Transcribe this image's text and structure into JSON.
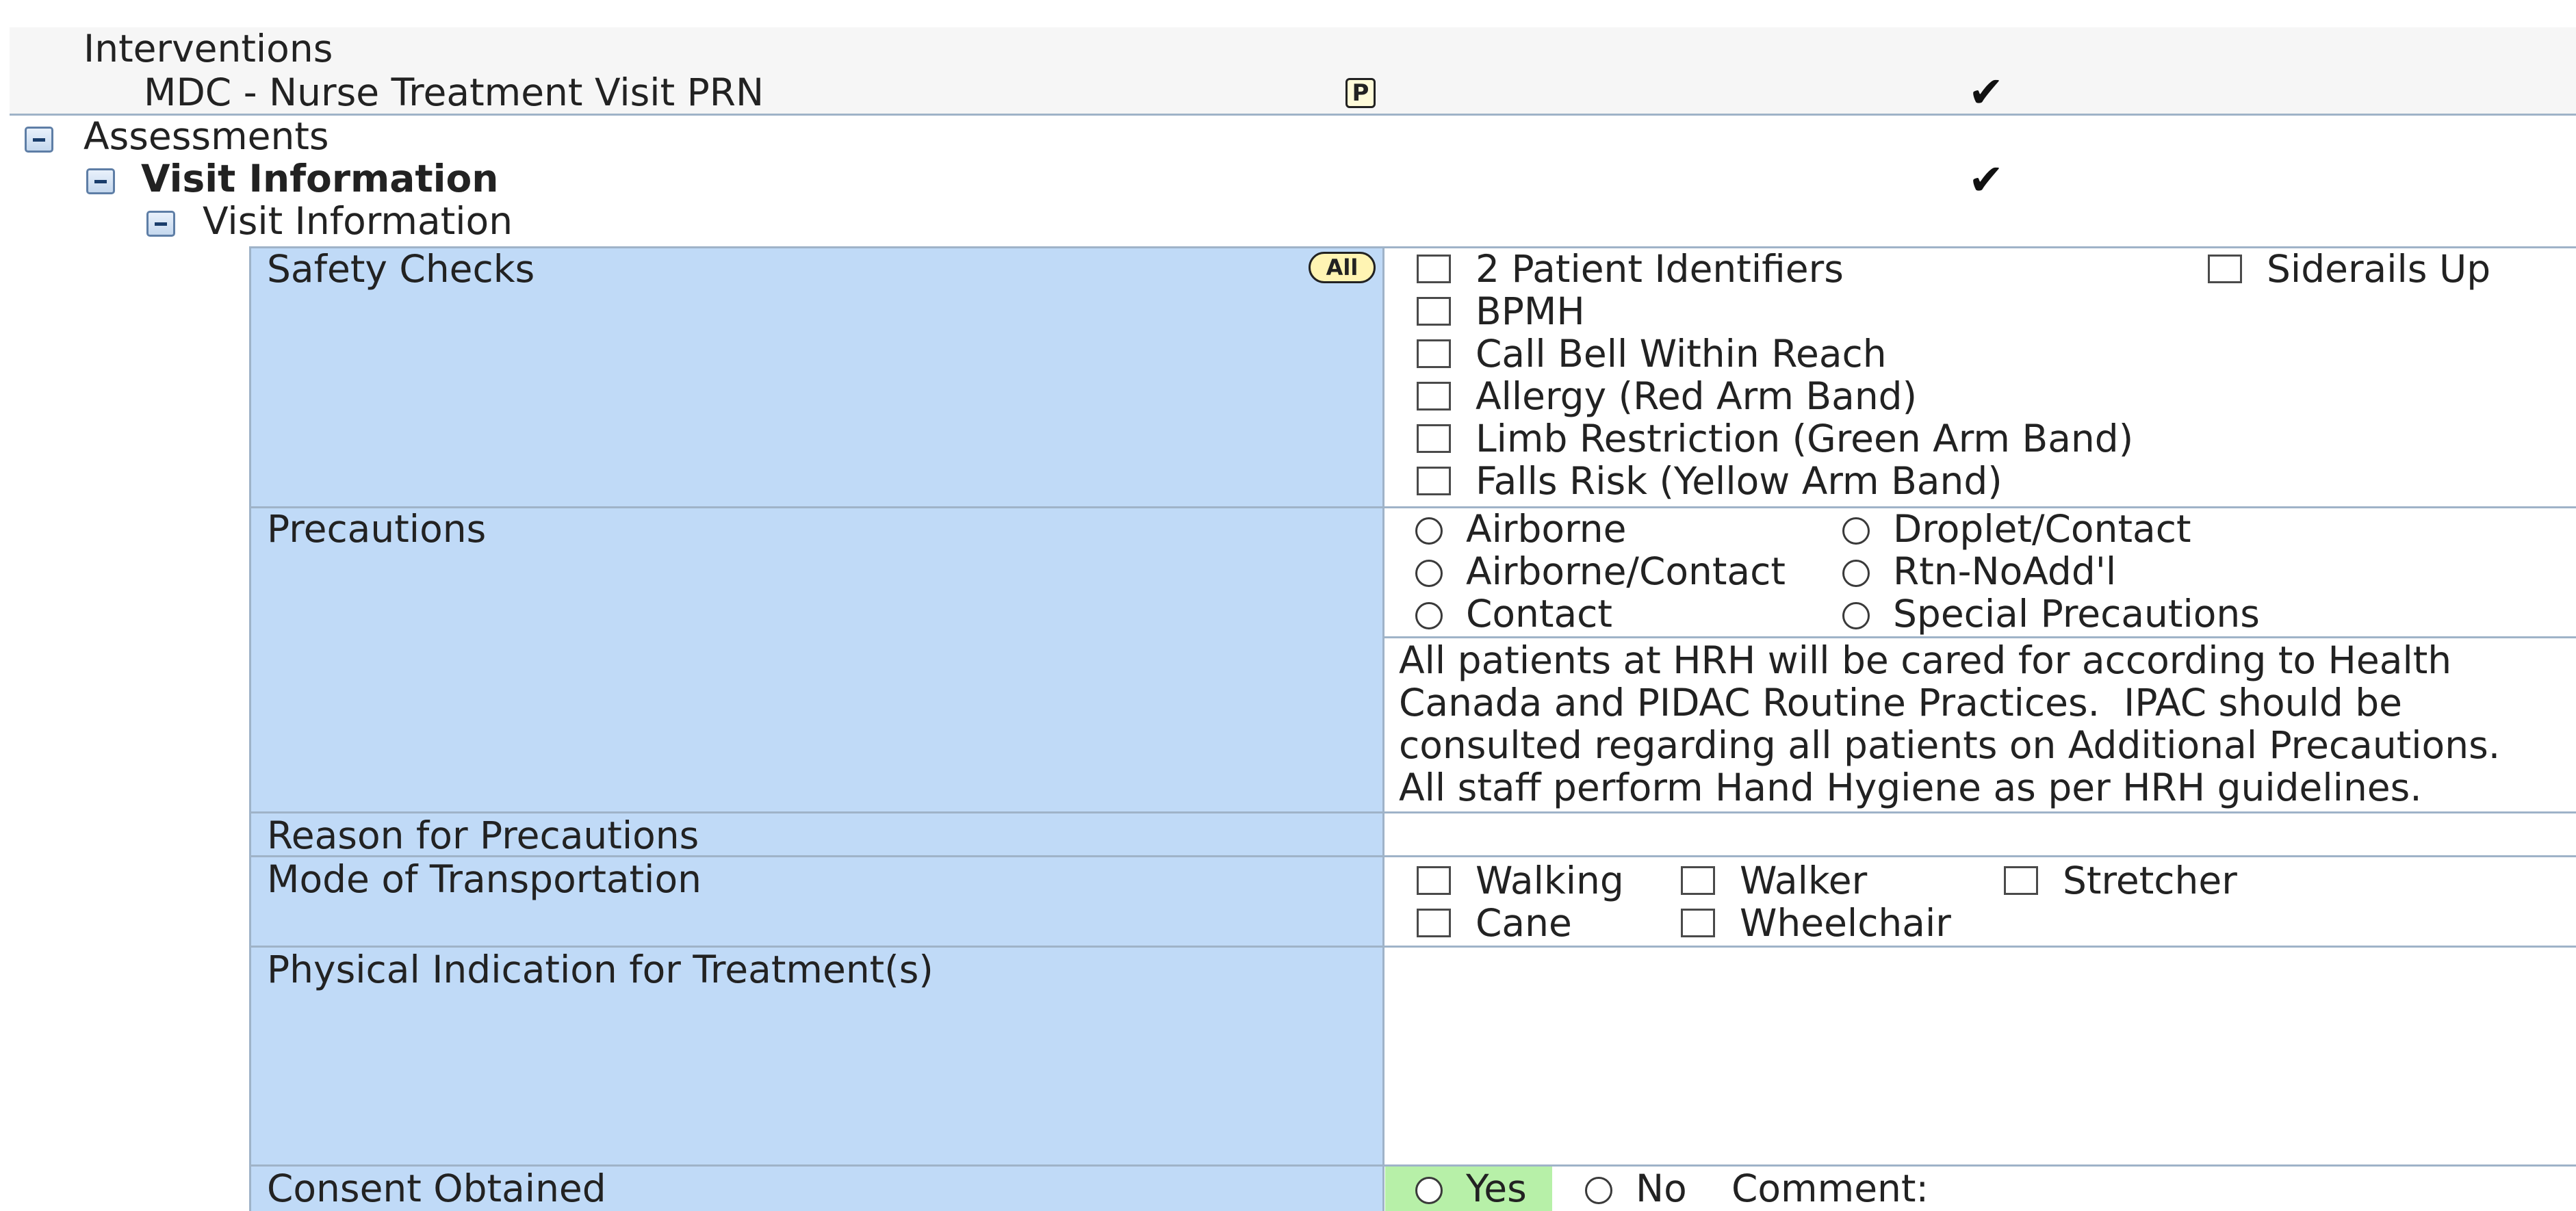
{
  "interventions": {
    "header": "Interventions",
    "item_label": "MDC - Nurse Treatment Visit PRN",
    "item_badge": "P",
    "item_check": "✔"
  },
  "assessments": {
    "header": "Assessments",
    "visit_info_bold": "Visit Information",
    "visit_info_check": "✔",
    "visit_info_sub": "Visit Information"
  },
  "form": {
    "safety_checks": {
      "label": "Safety Checks",
      "all_badge": "All",
      "options": [
        "2 Patient Identifiers",
        "BPMH",
        "Call Bell Within Reach",
        "Allergy (Red Arm Band)",
        "Limb Restriction (Green Arm Band)",
        "Falls Risk (Yellow Arm Band)"
      ],
      "option_right": "Siderails Up"
    },
    "precautions": {
      "label": "Precautions",
      "options": [
        "Airborne",
        "Airborne/Contact",
        "Contact",
        "Droplet/Contact",
        "Rtn-NoAdd'l",
        "Special Precautions"
      ],
      "note_lines": [
        "All patients at HRH will be cared for according to Health",
        "Canada and PIDAC Routine Practices.  IPAC should be",
        "consulted regarding all patients on Additional Precautions.",
        "All staff perform Hand Hygiene as per HRH guidelines."
      ]
    },
    "reason_for_precautions": {
      "label": "Reason for Precautions"
    },
    "mode_of_transportation": {
      "label": "Mode of Transportation",
      "options": [
        "Walking",
        "Walker",
        "Stretcher",
        "Cane",
        "Wheelchair"
      ]
    },
    "physical_indication": {
      "label": "Physical Indication for Treatment(s)"
    },
    "consent_obtained": {
      "label": "Consent Obtained",
      "yes": "Yes",
      "no": "No",
      "comment_label": "Comment:",
      "selected": "Yes"
    }
  },
  "colors": {
    "label_panel": "#c0daf7",
    "grid_line": "#9fb3c8",
    "yes_highlight": "#b7f0a8"
  }
}
